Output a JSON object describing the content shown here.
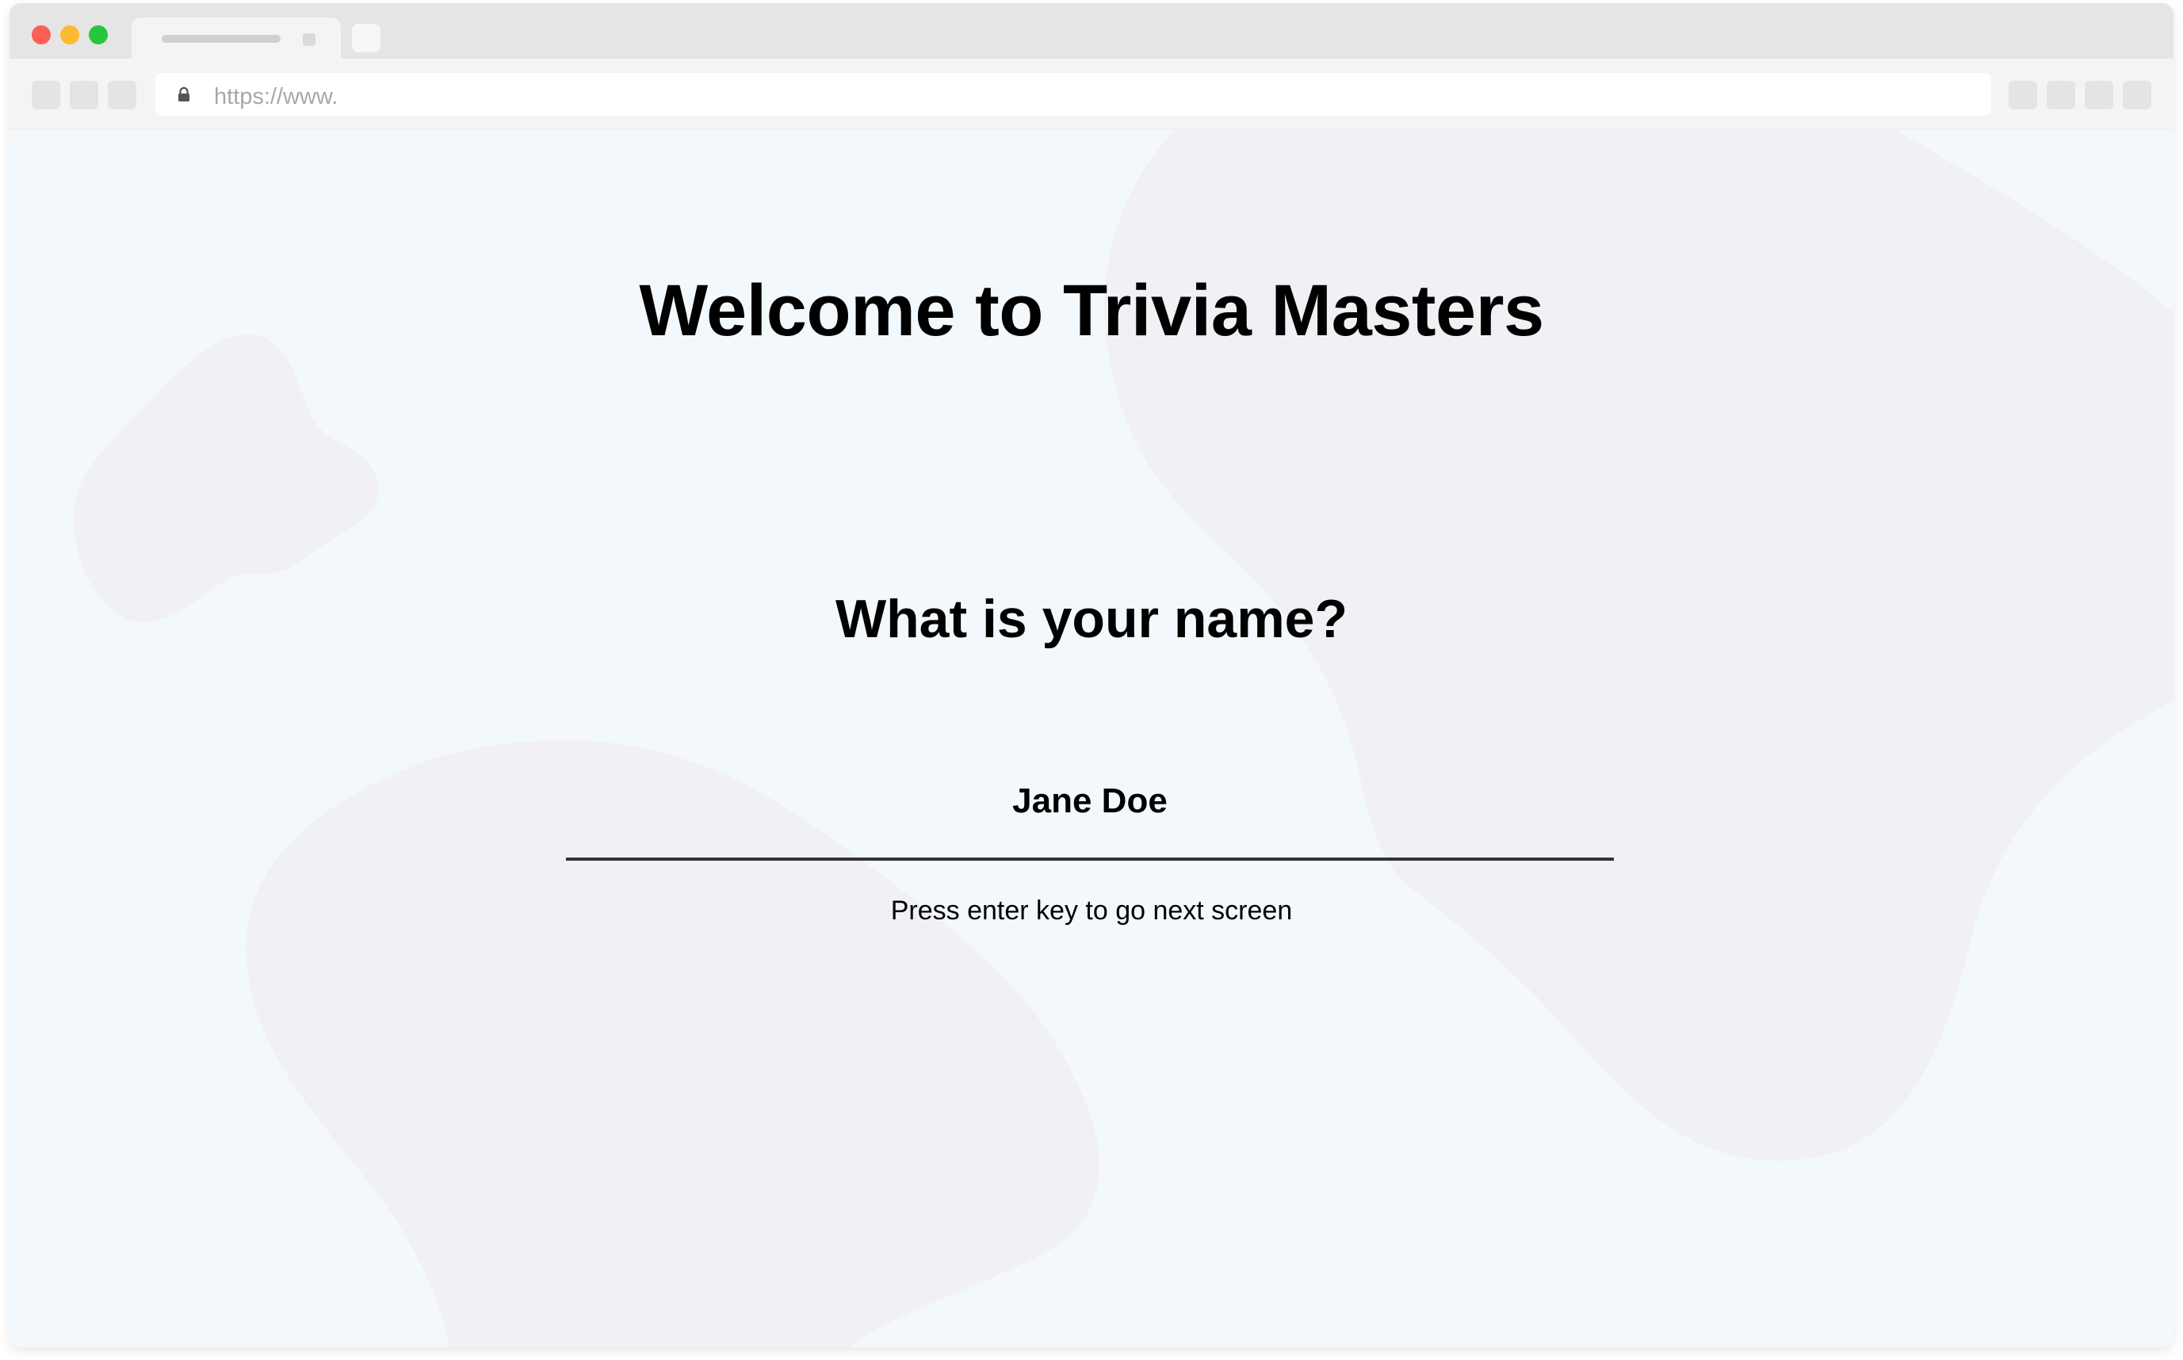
{
  "browser": {
    "url": "https://www."
  },
  "page": {
    "title": "Welcome to Trivia Masters",
    "question": "What is your name?",
    "name_value": "Jane Doe",
    "hint": "Press enter key to go next screen"
  },
  "colors": {
    "background": "#f3f8fc",
    "blob": "#f1f0f5",
    "underline": "#333333",
    "traffic_red": "#fd5e56",
    "traffic_yellow": "#fcbb2e",
    "traffic_green": "#26c63f"
  }
}
